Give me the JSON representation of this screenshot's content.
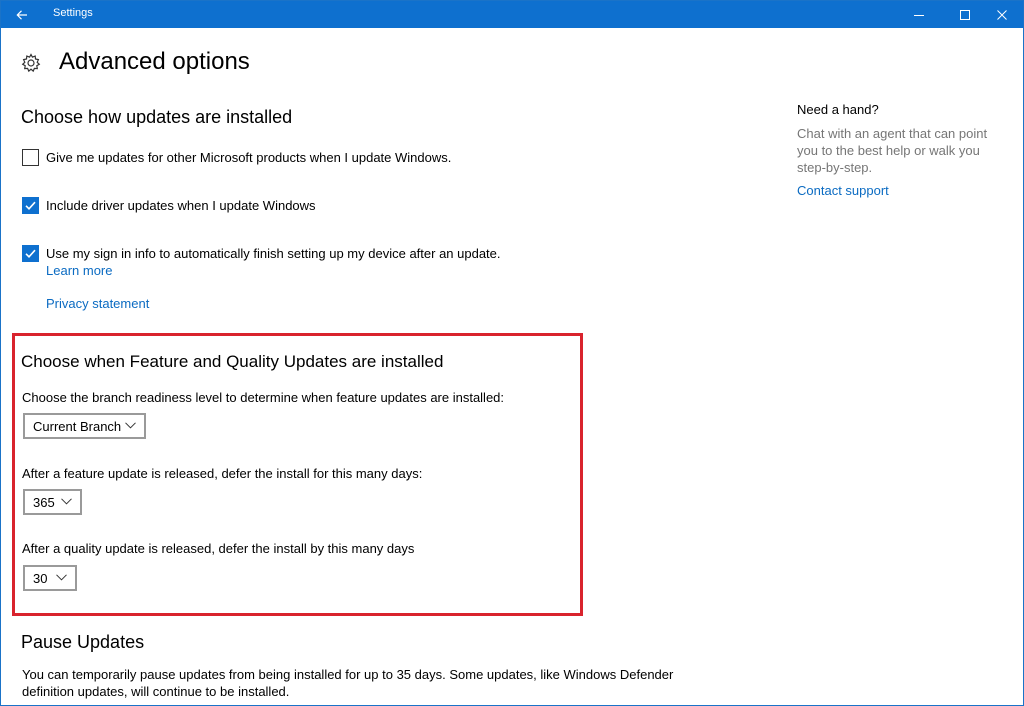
{
  "window": {
    "title": "Settings"
  },
  "header": {
    "title": "Advanced options"
  },
  "install_section": {
    "heading": "Choose how updates are installed",
    "options": [
      {
        "label": "Give me updates for other Microsoft products when I update Windows.",
        "checked": false
      },
      {
        "label": "Include driver updates when I update Windows",
        "checked": true
      },
      {
        "label": "Use my sign in info to automatically finish setting up my device after an update.",
        "checked": true
      }
    ],
    "learn_more": "Learn more",
    "privacy_statement": "Privacy statement"
  },
  "feature_quality_section": {
    "heading": "Choose when Feature and Quality Updates are installed",
    "branch_label": "Choose the branch readiness level to determine when feature updates are installed:",
    "branch_value": "Current Branch",
    "feature_defer_label": "After a feature update is released, defer the install for this many days:",
    "feature_defer_value": "365",
    "quality_defer_label": "After a quality update is released, defer the install by this many days",
    "quality_defer_value": "30"
  },
  "pause_section": {
    "heading": "Pause Updates",
    "description_line1": "You can temporarily pause updates from being installed for up to 35 days. Some updates, like Windows Defender",
    "description_line2": "definition updates, will continue to be installed."
  },
  "help_panel": {
    "title": "Need a hand?",
    "description": "Chat with an agent that can point you to the best help or walk you step-by-step.",
    "contact_link": "Contact support"
  },
  "colors": {
    "accent": "#0e70cf",
    "link": "#0b6bc2",
    "highlight": "#d9232d"
  }
}
